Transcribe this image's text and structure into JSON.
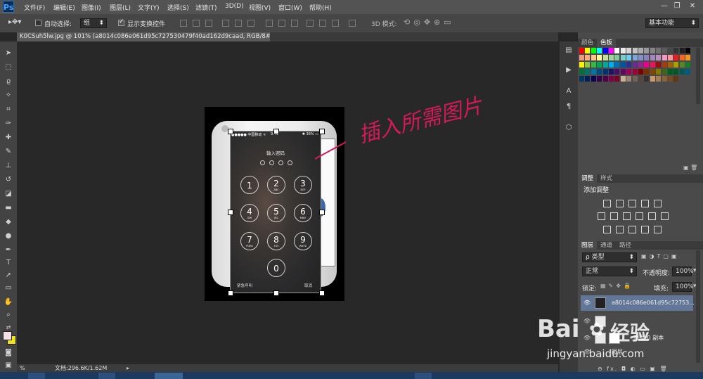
{
  "app": {
    "logo": "Ps"
  },
  "menu": [
    "文件(F)",
    "编辑(E)",
    "图像(I)",
    "图层(L)",
    "文字(Y)",
    "选择(S)",
    "滤镜(T)",
    "3D(D)",
    "视图(V)",
    "窗口(W)",
    "帮助(H)"
  ],
  "window_controls": {
    "minimize": "—",
    "restore": "❐",
    "close": "✕"
  },
  "options": {
    "auto_select_label": "自动选择:",
    "auto_select_value": "组",
    "show_transform_label": "显示变换控件",
    "mode_3d_label": "3D 模式:",
    "workspace": "基本功能"
  },
  "document": {
    "tab_title": "K0CSuh5lw.jpg @ 101% (a8014c086e061d95c727530479f40ad162d9caad, RGB/8#) * ✕",
    "annotation": "插入所需图片"
  },
  "phone_screen": {
    "status_left": "●●●●● 中国移动 ᯤ",
    "status_center": "9:41",
    "status_right": "✱ 36% ▭",
    "prompt": "输入密码",
    "keypad": [
      {
        "num": "1",
        "sub": ""
      },
      {
        "num": "2",
        "sub": "ABC"
      },
      {
        "num": "3",
        "sub": "DEF"
      },
      {
        "num": "4",
        "sub": "GHI"
      },
      {
        "num": "5",
        "sub": "JKL"
      },
      {
        "num": "6",
        "sub": "MNO"
      },
      {
        "num": "7",
        "sub": "PQRS"
      },
      {
        "num": "8",
        "sub": "TUV"
      },
      {
        "num": "9",
        "sub": "WXYZ"
      },
      {
        "num": "0",
        "sub": ""
      }
    ],
    "emergency": "紧急呼叫",
    "cancel": "取消"
  },
  "status": {
    "zoom": "%",
    "doc_size": "文档:296.6K/1.62M"
  },
  "panels": {
    "color_tabs": [
      "颜色",
      "色板"
    ],
    "swatch_colors": [
      "#ff0000",
      "#ffff00",
      "#00ff00",
      "#00ffff",
      "#0000ff",
      "#ff00ff",
      "#ffffff",
      "#ebebeb",
      "#d6d6d6",
      "#c2c2c2",
      "#adadad",
      "#999999",
      "#858585",
      "#707070",
      "#5c5c5c",
      "#474747",
      "#333333",
      "#1f1f1f",
      "#000000",
      "#f7977a",
      "#f9ad81",
      "#fdc68a",
      "#fff79a",
      "#c4df9b",
      "#a2d39c",
      "#82ca9d",
      "#7bcdc8",
      "#6ecff6",
      "#7ea7d8",
      "#8493ca",
      "#8882be",
      "#a187be",
      "#bc8dbf",
      "#f49ac2",
      "#f6989d",
      "#ed1c24",
      "#f26522",
      "#f7941d",
      "#fff200",
      "#8dc73f",
      "#39b54a",
      "#00a651",
      "#00a99d",
      "#00aeef",
      "#0072bc",
      "#0054a6",
      "#2e3192",
      "#662d91",
      "#92278f",
      "#ec008c",
      "#ed145b",
      "#9e0b0f",
      "#a0410d",
      "#a36209",
      "#aba000",
      "#598527",
      "#1a7b30",
      "#007236",
      "#00746b",
      "#0076a3",
      "#004b80",
      "#003471",
      "#1b1464",
      "#440e62",
      "#630460",
      "#9e005d",
      "#9e0039",
      "#790000",
      "#7b2e00",
      "#7d4900",
      "#827b00",
      "#406618",
      "#005e20",
      "#005826",
      "#005952",
      "#005b7f",
      "#003663",
      "#002157",
      "#0d004c",
      "#32004b",
      "#4b0049",
      "#7b0046",
      "#7a0026",
      "#c7b299",
      "#998675",
      "#736357",
      "#534741",
      "#37302d",
      "#c69c6d",
      "#a67c52",
      "#8c6239",
      "#754c24",
      "#603913"
    ],
    "adjust_tabs": [
      "调整",
      "样式"
    ],
    "adjust_title": "添加调整",
    "layers_tabs": [
      "图层",
      "通道",
      "路径"
    ],
    "layer_filter": "ρ 类型",
    "blend_mode": "正常",
    "opacity_label": "不透明度:",
    "opacity_value": "100%",
    "lock_label": "锁定:",
    "fill_label": "填充:",
    "fill_value": "100%",
    "layers": [
      {
        "name": "a8014c086e061d95c72753...",
        "visible": true,
        "selected": true
      },
      {
        "name": "图层 0 副本",
        "visible": true,
        "selected": false
      },
      {
        "name": "图层",
        "visible": true,
        "selected": false
      }
    ],
    "layer_footer_icons": "⊖ fx. ◘ ◐ ▭ ▣ 🗑"
  },
  "watermark": {
    "brand": "Bai",
    "brand2": "经验",
    "url": "jingyan.baidu.com"
  }
}
